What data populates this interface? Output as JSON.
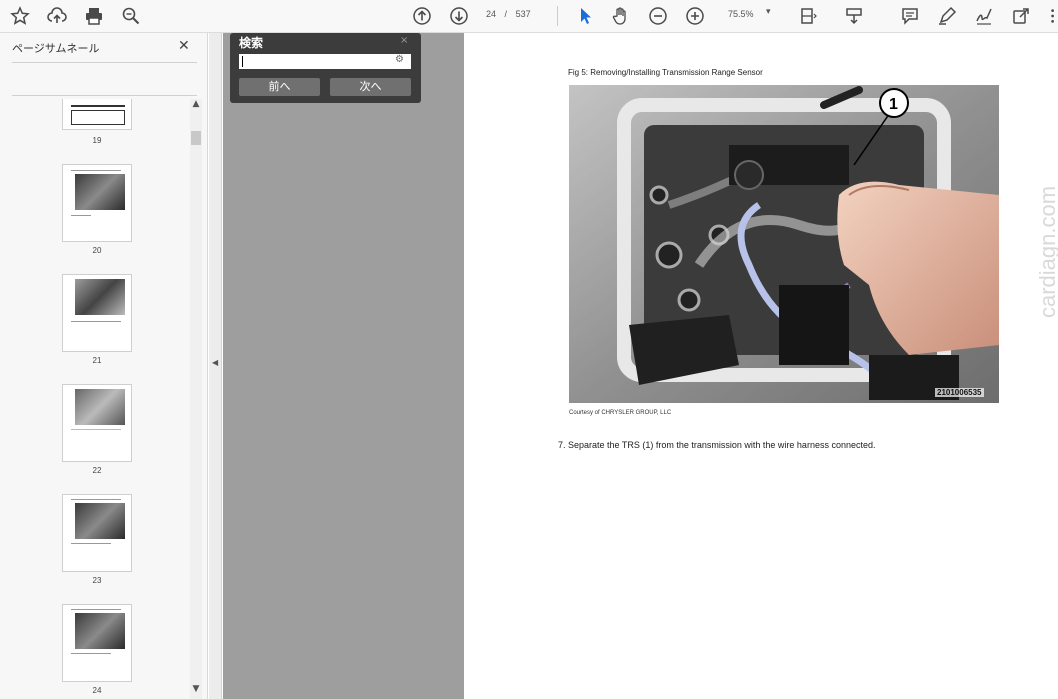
{
  "toolbar": {
    "icons": [
      "star-icon",
      "cloud-upload-icon",
      "print-icon",
      "zoom-search-icon",
      "page-up-icon",
      "page-down-icon",
      "select-cursor-icon",
      "hand-icon",
      "zoom-out-icon",
      "zoom-in-icon",
      "fit-page-icon",
      "scroll-mode-icon",
      "comment-icon",
      "highlight-icon",
      "sign-icon",
      "share-icon",
      "more-icon"
    ],
    "current_page": "24",
    "separator": "/",
    "total_pages": "537",
    "zoom": "75.5%",
    "zoom_dropdown": "▾"
  },
  "sidebar": {
    "title": "ページサムネール",
    "close": "✕",
    "thumbnails": [
      {
        "page": "19"
      },
      {
        "page": "20"
      },
      {
        "page": "21"
      },
      {
        "page": "22"
      },
      {
        "page": "23"
      },
      {
        "page": "24"
      }
    ]
  },
  "search": {
    "title": "検索",
    "close": "×",
    "value": "",
    "prev_label": "前へ",
    "next_label": "次へ"
  },
  "document": {
    "figure_caption": "Fig 5: Removing/Installing Transmission Range Sensor",
    "callout": "1",
    "image_id": "2101006535",
    "credit": "Courtesy of CHRYSLER GROUP, LLC",
    "step_text": "7. Separate the TRS (1) from the transmission with the wire harness connected.",
    "watermark": "cardiagn.com"
  },
  "colors": {
    "accent": "#1a6ed8",
    "canvas": "#9e9e9e",
    "search_bg": "#3c3c3c"
  }
}
